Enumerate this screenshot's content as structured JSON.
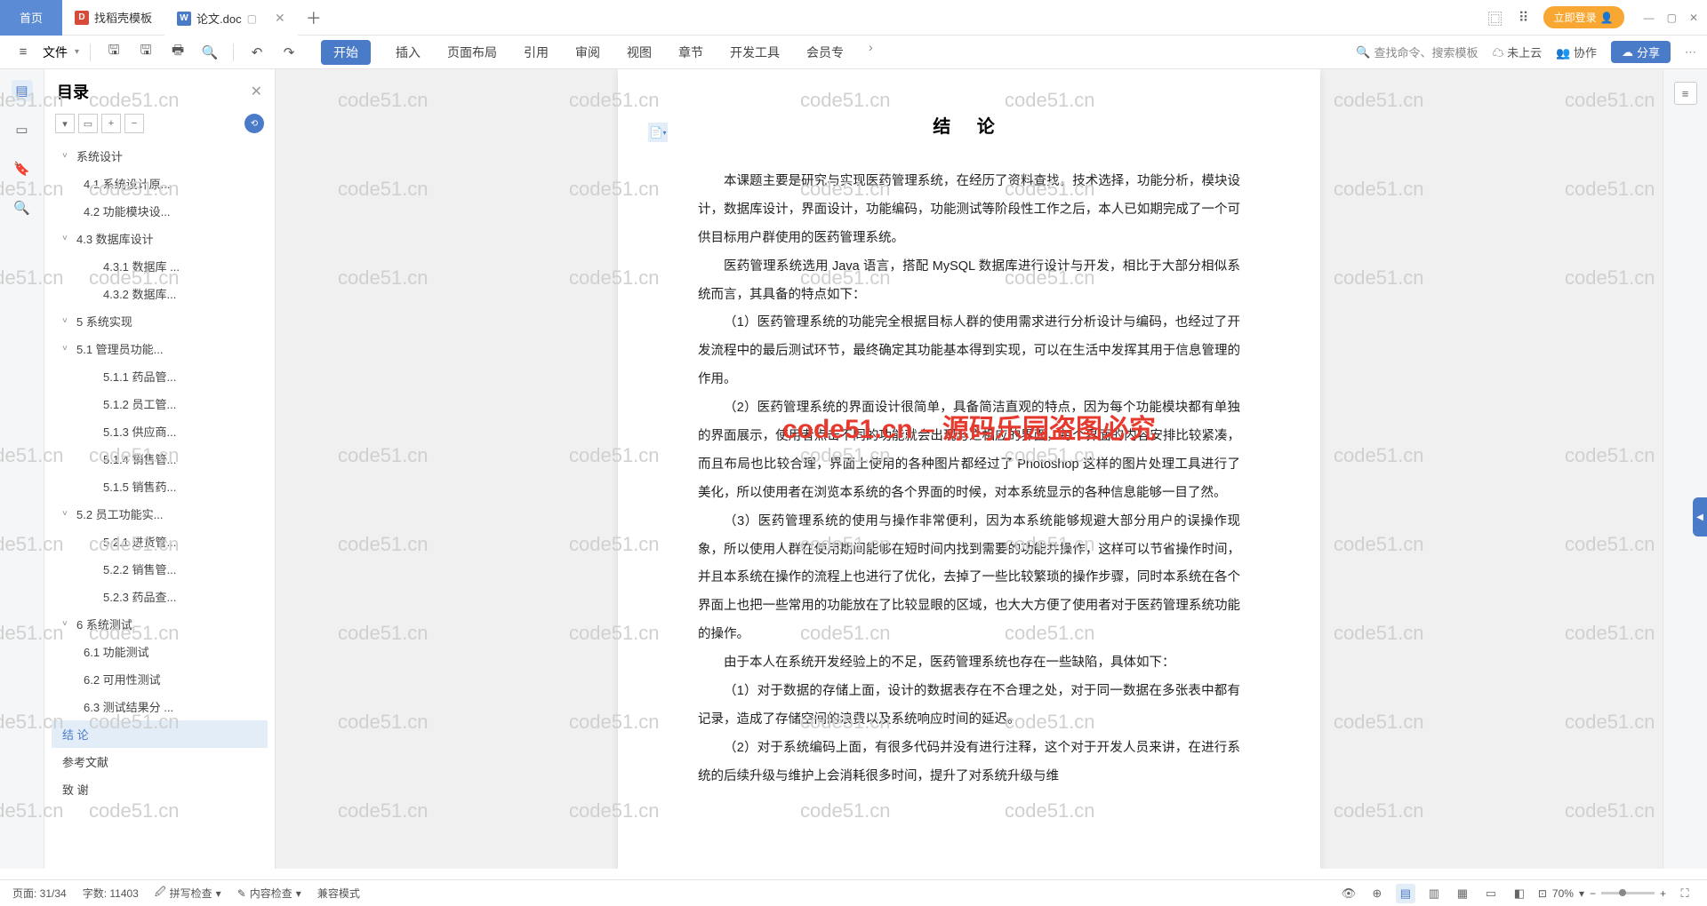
{
  "tabs": {
    "home": "首页",
    "template": "找稻壳模板",
    "doc": "论文.doc"
  },
  "title_right": {
    "login": "立即登录"
  },
  "ribbon": {
    "file": "文件",
    "menu": [
      "开始",
      "插入",
      "页面布局",
      "引用",
      "审阅",
      "视图",
      "章节",
      "开发工具",
      "会员专"
    ],
    "search": "查找命令、搜索模板",
    "cloud": "未上云",
    "collab": "协作",
    "share": "分享"
  },
  "outline": {
    "title": "目录",
    "items": [
      {
        "l": 1,
        "chev": "˅",
        "t": "系统设计"
      },
      {
        "l": 2,
        "t": "4.1  系统设计原..."
      },
      {
        "l": 2,
        "t": "4.2  功能模块设..."
      },
      {
        "l": 1,
        "chev": "˅",
        "t": "4.3  数据库设计"
      },
      {
        "l": 3,
        "t": "4.3.1  数据库 ..."
      },
      {
        "l": 3,
        "t": "4.3.2  数据库..."
      },
      {
        "l": 1,
        "chev": "˅",
        "t": "5  系统实现"
      },
      {
        "l": 1,
        "chev": "˅",
        "t": "5.1  管理员功能..."
      },
      {
        "l": 3,
        "t": "5.1.1  药品管..."
      },
      {
        "l": 3,
        "t": "5.1.2  员工管..."
      },
      {
        "l": 3,
        "t": "5.1.3  供应商..."
      },
      {
        "l": 3,
        "t": "5.1.4  销售管..."
      },
      {
        "l": 3,
        "t": "5.1.5  销售药..."
      },
      {
        "l": 1,
        "chev": "˅",
        "t": "5.2  员工功能实..."
      },
      {
        "l": 3,
        "t": "5.2.1  进货管..."
      },
      {
        "l": 3,
        "t": "5.2.2  销售管..."
      },
      {
        "l": 3,
        "t": "5.2.3  药品查..."
      },
      {
        "l": 1,
        "chev": "˅",
        "t": "6  系统测试"
      },
      {
        "l": 2,
        "t": "6.1  功能测试"
      },
      {
        "l": 2,
        "t": "6.2  可用性测试"
      },
      {
        "l": 2,
        "t": "6.3  测试结果分 ..."
      },
      {
        "l": 1,
        "t": "结    论",
        "active": true
      },
      {
        "l": 1,
        "t": "参考文献"
      },
      {
        "l": 1,
        "t": "致    谢"
      }
    ]
  },
  "doc": {
    "heading": "结    论",
    "p1": "本课题主要是研究与实现医药管理系统，在经历了资料查找，技术选择，功能分析，模块设计，数据库设计，界面设计，功能编码，功能测试等阶段性工作之后，本人已如期完成了一个可供目标用户群使用的医药管理系统。",
    "p2": "医药管理系统选用 Java 语言，搭配 MySQL 数据库进行设计与开发，相比于大部分相似系统而言，其具备的特点如下：",
    "p3": "（1）医药管理系统的功能完全根据目标人群的使用需求进行分析设计与编码，也经过了开发流程中的最后测试环节，最终确定其功能基本得到实现，可以在生活中发挥其用于信息管理的作用。",
    "p4": "（2）医药管理系统的界面设计很简单，具备简洁直观的特点，因为每个功能模块都有单独的界面展示，使用者点击不同的功能就会出现与之相应的界面，每个界面的内容安排比较紧凑，而且布局也比较合理，界面上使用的各种图片都经过了 Photoshop 这样的图片处理工具进行了美化，所以使用者在浏览本系统的各个界面的时候，对本系统显示的各种信息能够一目了然。",
    "p5": "（3）医药管理系统的使用与操作非常便利，因为本系统能够规避大部分用户的误操作现象，所以使用人群在使用期间能够在短时间内找到需要的功能并操作，这样可以节省操作时间，并且本系统在操作的流程上也进行了优化，去掉了一些比较繁琐的操作步骤，同时本系统在各个界面上也把一些常用的功能放在了比较显眼的区域，也大大方便了使用者对于医药管理系统功能的操作。",
    "p6": "由于本人在系统开发经验上的不足，医药管理系统也存在一些缺陷，具体如下：",
    "p7": "（1）对于数据的存储上面，设计的数据表存在不合理之处，对于同一数据在多张表中都有记录，造成了存储空间的浪费以及系统响应时间的延迟。",
    "p8": "（2）对于系统编码上面，有很多代码并没有进行注释，这个对于开发人员来讲，在进行系统的后续升级与维护上会消耗很多时间，提升了对系统升级与维"
  },
  "watermark": {
    "main": "code51.cn – 源码乐园盗图必究",
    "bg": "code51.cn"
  },
  "status": {
    "page": "页面: 31/34",
    "words": "字数: 11403",
    "spell": "拼写检查",
    "content": "内容检查",
    "compat": "兼容模式",
    "zoom": "70%"
  }
}
